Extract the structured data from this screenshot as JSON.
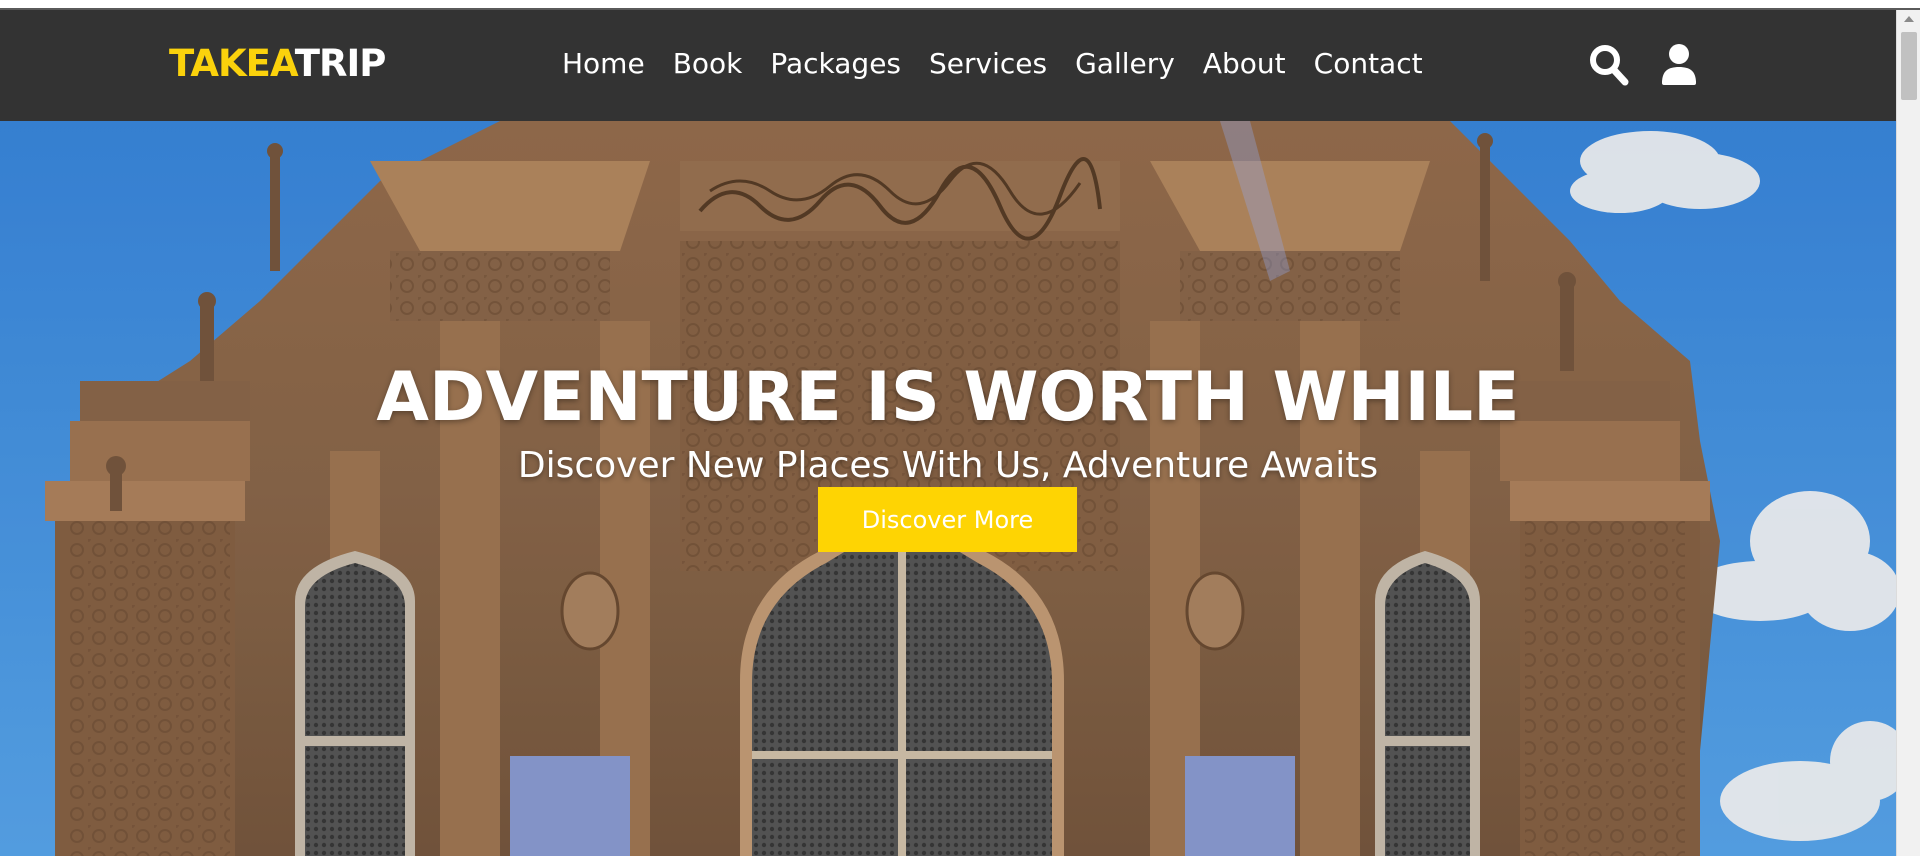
{
  "header": {
    "logo": {
      "part1": "TAKEA",
      "part2": "TRIP"
    },
    "nav": [
      {
        "label": "Home"
      },
      {
        "label": "Book"
      },
      {
        "label": "Packages"
      },
      {
        "label": "Services"
      },
      {
        "label": "Gallery"
      },
      {
        "label": "About"
      },
      {
        "label": "Contact"
      }
    ],
    "icons": {
      "search": "search-icon",
      "user": "user-icon"
    }
  },
  "hero": {
    "title": "ADVENTURE IS WORTH WHILE",
    "subtitle": "Discover New Places With Us, Adventure Awaits",
    "button_label": "Discover More",
    "background": "photo of ornate carved stone mosque facade against blue sky"
  },
  "colors": {
    "header_bg": "#333333",
    "logo_accent": "#fbd20c",
    "button_bg": "#fed403",
    "text": "#ffffff",
    "sky": "#4a9cf0",
    "stone": "#a0714a"
  }
}
